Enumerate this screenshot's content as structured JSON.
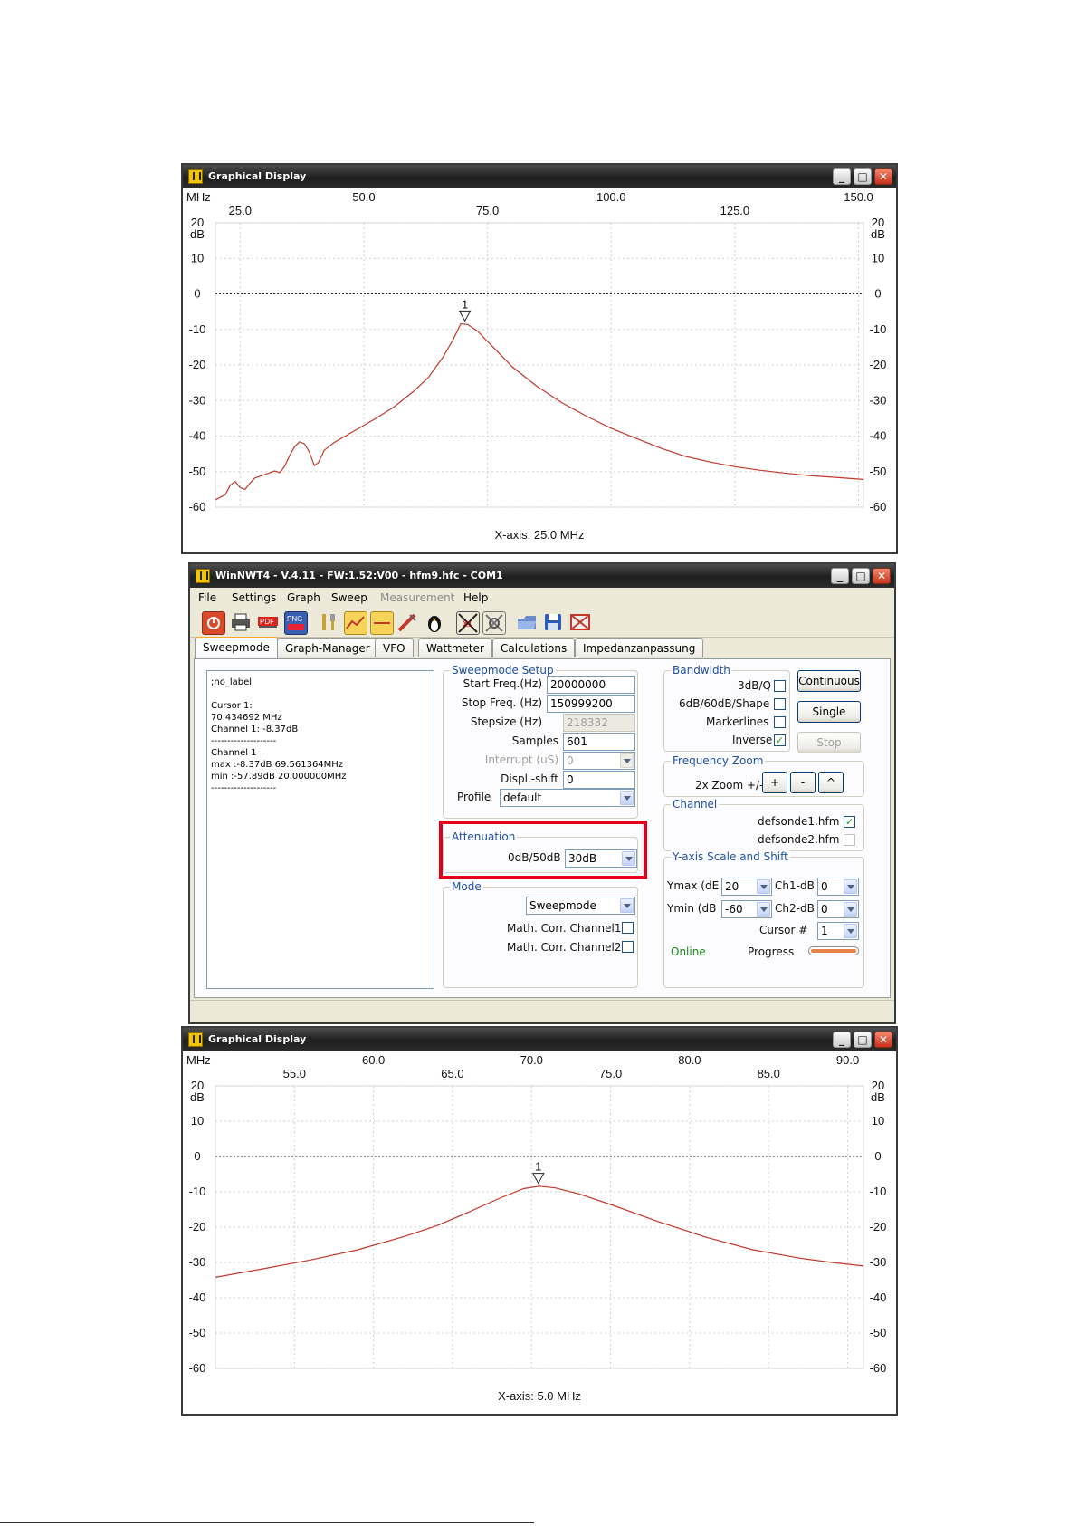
{
  "graph_top": {
    "title": "Graphical Display",
    "freq_unit": "MHz",
    "db_unit": "dB",
    "x_axis_label": "X-axis: 25.0 MHz",
    "marker": "1",
    "window_buttons": {
      "minimize": "_",
      "maximize": "□",
      "close": "✕"
    }
  },
  "main_window": {
    "title": "WinNWT4 - V.4.11 - FW:1.52:V00 - hfm9.hfc - COM1",
    "menu": [
      "File",
      "Settings",
      "Graph",
      "Sweep",
      "Measurement",
      "Help"
    ],
    "toolbar_icons": [
      "power-icon",
      "print-icon",
      "pdf-icon",
      "png-icon",
      "tools-icon",
      "chart-icon",
      "chart-small-icon",
      "probe-icon",
      "penguin-icon",
      "zoom-x1-icon",
      "zoom-fit-icon",
      "open-folder-icon",
      "save-disk-icon",
      "close-file-icon"
    ],
    "tabs": [
      "Sweepmode",
      "Graph-Manager",
      "VFO",
      "Wattmeter",
      "Calculations",
      "Impedanzanpassung"
    ],
    "info_lines": [
      ";no_label",
      "",
      "Cursor 1:",
      "70.434692 MHz",
      "Channel 1: -8.37dB",
      "--------------------",
      "Channel 1",
      "max :-8.37dB 69.561364MHz",
      "min :-57.89dB 20.000000MHz",
      "--------------------"
    ],
    "sweep_setup": {
      "title": "Sweepmode Setup",
      "start_freq_label": "Start Freq.(Hz)",
      "start_freq": "20000000",
      "stop_freq_label": "Stop Freq. (Hz)",
      "stop_freq": "150999200",
      "stepsize_label": "Stepsize (Hz)",
      "stepsize": "218332",
      "samples_label": "Samples",
      "samples": "601",
      "interrupt_label": "Interrupt (uS)",
      "interrupt": "0",
      "displ_shift_label": "Displ.-shift",
      "displ_shift": "0",
      "profile_label": "Profile",
      "profile": "default"
    },
    "attenuation": {
      "title": "Attenuation",
      "label": "0dB/50dB",
      "value": "30dB"
    },
    "mode": {
      "title": "Mode",
      "value": "Sweepmode",
      "corr1_label": "Math. Corr. Channel1",
      "corr2_label": "Math. Corr. Channel2"
    },
    "bandwidth": {
      "title": "Bandwidth",
      "q_label": "3dB/Q",
      "shape_label": "6dB/60dB/Shape",
      "markerlines_label": "Markerlines",
      "inverse_label": "Inverse",
      "checkmark": "✓"
    },
    "buttons": {
      "continuous": "Continuous",
      "single": "Single",
      "stop": "Stop"
    },
    "freq_zoom": {
      "title": "Frequency Zoom",
      "label": "2x Zoom +/-",
      "plus": "+",
      "minus": "-",
      "reset": "^"
    },
    "channel": {
      "title": "Channel",
      "probe1": "defsonde1.hfm",
      "probe2": "defsonde2.hfm"
    },
    "yaxis": {
      "title": "Y-axis Scale and Shift",
      "ymax_label": "Ymax (dE",
      "ymax": "20",
      "ymin_label": "Ymin (dB",
      "ymin": "-60",
      "ch1_label": "Ch1-dB",
      "ch1": "0",
      "ch2_label": "Ch2-dB",
      "ch2": "0",
      "cursor_label": "Cursor #",
      "cursor": "1"
    },
    "online": "Online",
    "progress_label": "Progress",
    "colors": {
      "online": "#1a8a1a",
      "group_title": "#1f4fa0",
      "highlight": "#e2001a"
    }
  },
  "graph_bottom": {
    "title": "Graphical Display",
    "freq_unit": "MHz",
    "db_unit": "dB",
    "x_axis_label": "X-axis: 5.0 MHz",
    "marker": "1",
    "window_buttons": {
      "minimize": "_",
      "maximize": "□",
      "close": "✕"
    }
  },
  "chart_data": [
    {
      "type": "line",
      "title": "Graphical Display",
      "xlabel": "X-axis: 25.0 MHz",
      "ylabel": "dB",
      "xlim": [
        20,
        151
      ],
      "ylim": [
        -60,
        20
      ],
      "x_ticks_top": [
        50.0,
        100.0,
        150.0
      ],
      "x_ticks_bottom": [
        25.0,
        75.0,
        125.0
      ],
      "y_ticks": [
        20,
        10,
        0,
        -10,
        -20,
        -30,
        -40,
        -50,
        -60
      ],
      "grid": true,
      "reference_line_y": 0,
      "color": "#c0392b",
      "marker": {
        "label": "1",
        "x": 70.43,
        "y": -8.37
      },
      "series": [
        {
          "values": [
            [
              20,
              -57.9
            ],
            [
              22,
              -56.5
            ],
            [
              23,
              -53.8
            ],
            [
              24,
              -52.8
            ],
            [
              25,
              -54.5
            ],
            [
              26,
              -55
            ],
            [
              27,
              -53.2
            ],
            [
              28,
              -51.8
            ],
            [
              30,
              -50.8
            ],
            [
              32,
              -49.8
            ],
            [
              33,
              -50.3
            ],
            [
              34,
              -48.5
            ],
            [
              35,
              -45.5
            ],
            [
              36,
              -43
            ],
            [
              37,
              -41.6
            ],
            [
              38,
              -42.2
            ],
            [
              39,
              -44.5
            ],
            [
              40,
              -48.3
            ],
            [
              40.8,
              -47.5
            ],
            [
              42,
              -44
            ],
            [
              44,
              -41.8
            ],
            [
              48,
              -38.6
            ],
            [
              52,
              -35.4
            ],
            [
              56,
              -31.9
            ],
            [
              60,
              -27.5
            ],
            [
              63,
              -23.6
            ],
            [
              66,
              -17.8
            ],
            [
              68,
              -13
            ],
            [
              69.6,
              -8.4
            ],
            [
              71,
              -8.6
            ],
            [
              73,
              -10.5
            ],
            [
              76,
              -14.8
            ],
            [
              80,
              -20.5
            ],
            [
              85,
              -26
            ],
            [
              90,
              -30.6
            ],
            [
              95,
              -34.4
            ],
            [
              100,
              -37.8
            ],
            [
              105,
              -40.6
            ],
            [
              110,
              -43.4
            ],
            [
              115,
              -45.7
            ],
            [
              120,
              -47.3
            ],
            [
              125,
              -48.6
            ],
            [
              130,
              -49.6
            ],
            [
              135,
              -50.4
            ],
            [
              140,
              -51.1
            ],
            [
              145,
              -51.6
            ],
            [
              151,
              -52.2
            ]
          ]
        }
      ]
    },
    {
      "type": "line",
      "title": "Graphical Display",
      "xlabel": "X-axis: 5.0 MHz",
      "ylabel": "dB",
      "xlim": [
        50,
        91
      ],
      "ylim": [
        -60,
        20
      ],
      "x_ticks_top": [
        60.0,
        70.0,
        80.0,
        90.0
      ],
      "x_ticks_bottom": [
        55.0,
        65.0,
        75.0,
        85.0
      ],
      "y_ticks": [
        20,
        10,
        0,
        -10,
        -20,
        -30,
        -40,
        -50,
        -60
      ],
      "grid": true,
      "reference_line_y": 0,
      "color": "#c0392b",
      "marker": {
        "label": "1",
        "x": 70.43,
        "y": -8.37
      },
      "series": [
        {
          "values": [
            [
              50,
              -34.2
            ],
            [
              53,
              -31.8
            ],
            [
              56,
              -29.3
            ],
            [
              59,
              -26.4
            ],
            [
              62,
              -22.6
            ],
            [
              64,
              -19.6
            ],
            [
              66,
              -15.8
            ],
            [
              68,
              -11.8
            ],
            [
              69.5,
              -9.1
            ],
            [
              70.5,
              -8.4
            ],
            [
              71.5,
              -8.9
            ],
            [
              73,
              -10.6
            ],
            [
              75,
              -13.6
            ],
            [
              78,
              -18.4
            ],
            [
              81,
              -22.8
            ],
            [
              84,
              -26.4
            ],
            [
              87,
              -28.8
            ],
            [
              89,
              -30
            ],
            [
              91,
              -31
            ]
          ]
        }
      ]
    }
  ]
}
